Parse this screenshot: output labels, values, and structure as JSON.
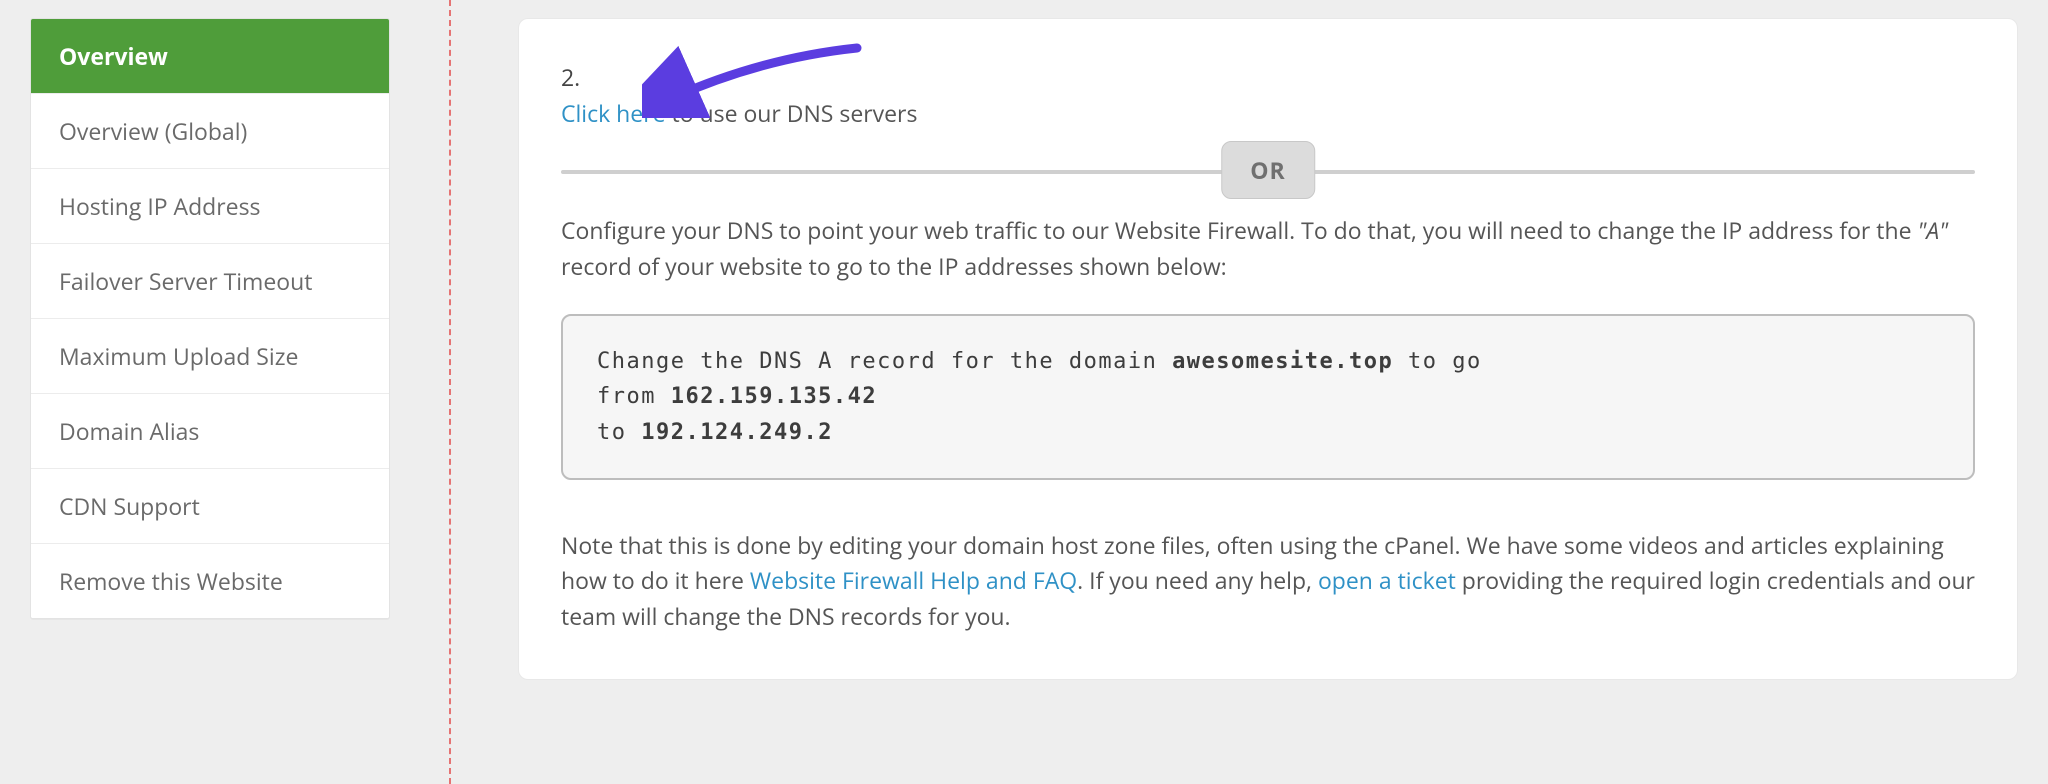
{
  "sidebar": {
    "items": [
      {
        "label": "Overview",
        "active": true
      },
      {
        "label": "Overview (Global)",
        "active": false
      },
      {
        "label": "Hosting IP Address",
        "active": false
      },
      {
        "label": "Failover Server Timeout",
        "active": false
      },
      {
        "label": "Maximum Upload Size",
        "active": false
      },
      {
        "label": "Domain Alias",
        "active": false
      },
      {
        "label": "CDN Support",
        "active": false
      },
      {
        "label": "Remove this Website",
        "active": false
      }
    ]
  },
  "step": {
    "number": "2.",
    "click_here": "Click here",
    "dns_tail": " to use our DNS servers"
  },
  "or_label": "OR",
  "configure_text_1": "Configure your DNS to point your web traffic to our Website Firewall. To do that, you will need to change the IP address for the ",
  "a_quote": "\"A\"",
  "configure_text_2": " record of your website to go to the IP addresses shown below:",
  "codebox": {
    "line1_pre": "Change the DNS A record for the domain ",
    "domain": "awesomesite.top",
    "line1_post": " to go",
    "line2_pre": "from ",
    "from_ip": "162.159.135.42",
    "line3_pre": "to ",
    "to_ip": "192.124.249.2"
  },
  "note": {
    "part1": "Note that this is done by editing your domain host zone files, often using the cPanel. We have some videos and articles explaining how to do it here ",
    "help_link": "Website Firewall Help and FAQ",
    "part2": ". If you need any help, ",
    "ticket_link": "open a ticket",
    "part3": " providing the required login credentials and our team will change the DNS records for you."
  },
  "colors": {
    "accent_green": "#4f9d3a",
    "link_blue": "#2f91c6",
    "arrow_purple": "#5b3de0"
  }
}
